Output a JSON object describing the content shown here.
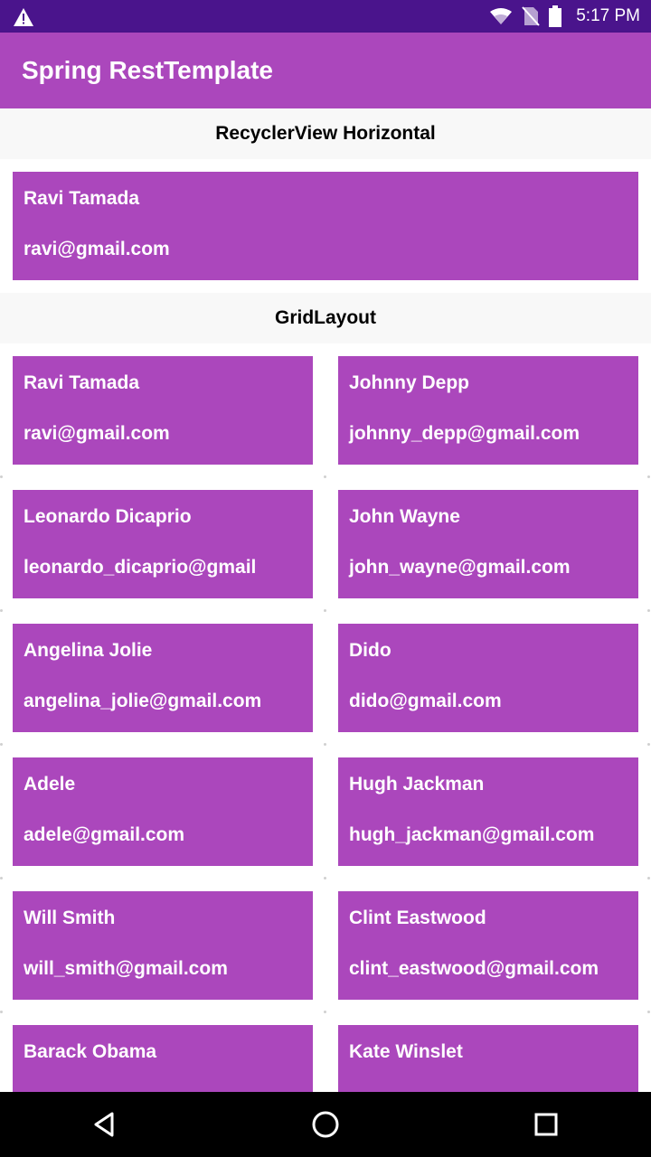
{
  "status": {
    "time": "5:17 PM"
  },
  "app": {
    "title": "Spring RestTemplate"
  },
  "recycler": {
    "header": "RecyclerView Horizontal",
    "items": [
      {
        "name": "Ravi Tamada",
        "email": "ravi@gmail.com"
      }
    ]
  },
  "grid": {
    "header": "GridLayout",
    "items": [
      {
        "name": "Ravi Tamada",
        "email": "ravi@gmail.com"
      },
      {
        "name": "Johnny Depp",
        "email": "johnny_depp@gmail.com"
      },
      {
        "name": "Leonardo Dicaprio",
        "email": "leonardo_dicaprio@gmail"
      },
      {
        "name": "John Wayne",
        "email": "john_wayne@gmail.com"
      },
      {
        "name": "Angelina Jolie",
        "email": "angelina_jolie@gmail.com"
      },
      {
        "name": "Dido",
        "email": "dido@gmail.com"
      },
      {
        "name": "Adele",
        "email": "adele@gmail.com"
      },
      {
        "name": "Hugh Jackman",
        "email": "hugh_jackman@gmail.com"
      },
      {
        "name": "Will Smith",
        "email": "will_smith@gmail.com"
      },
      {
        "name": "Clint Eastwood",
        "email": "clint_eastwood@gmail.com"
      },
      {
        "name": "Barack Obama",
        "email": ""
      },
      {
        "name": "Kate Winslet",
        "email": ""
      }
    ]
  },
  "colors": {
    "status_bar": "#4a148c",
    "primary": "#ab47bc",
    "card": "#ab47bc"
  },
  "icons": {
    "status": [
      "warning-icon",
      "wifi-icon",
      "no-sim-icon",
      "battery-icon"
    ],
    "nav": [
      "back-icon",
      "home-icon",
      "recents-icon"
    ]
  }
}
